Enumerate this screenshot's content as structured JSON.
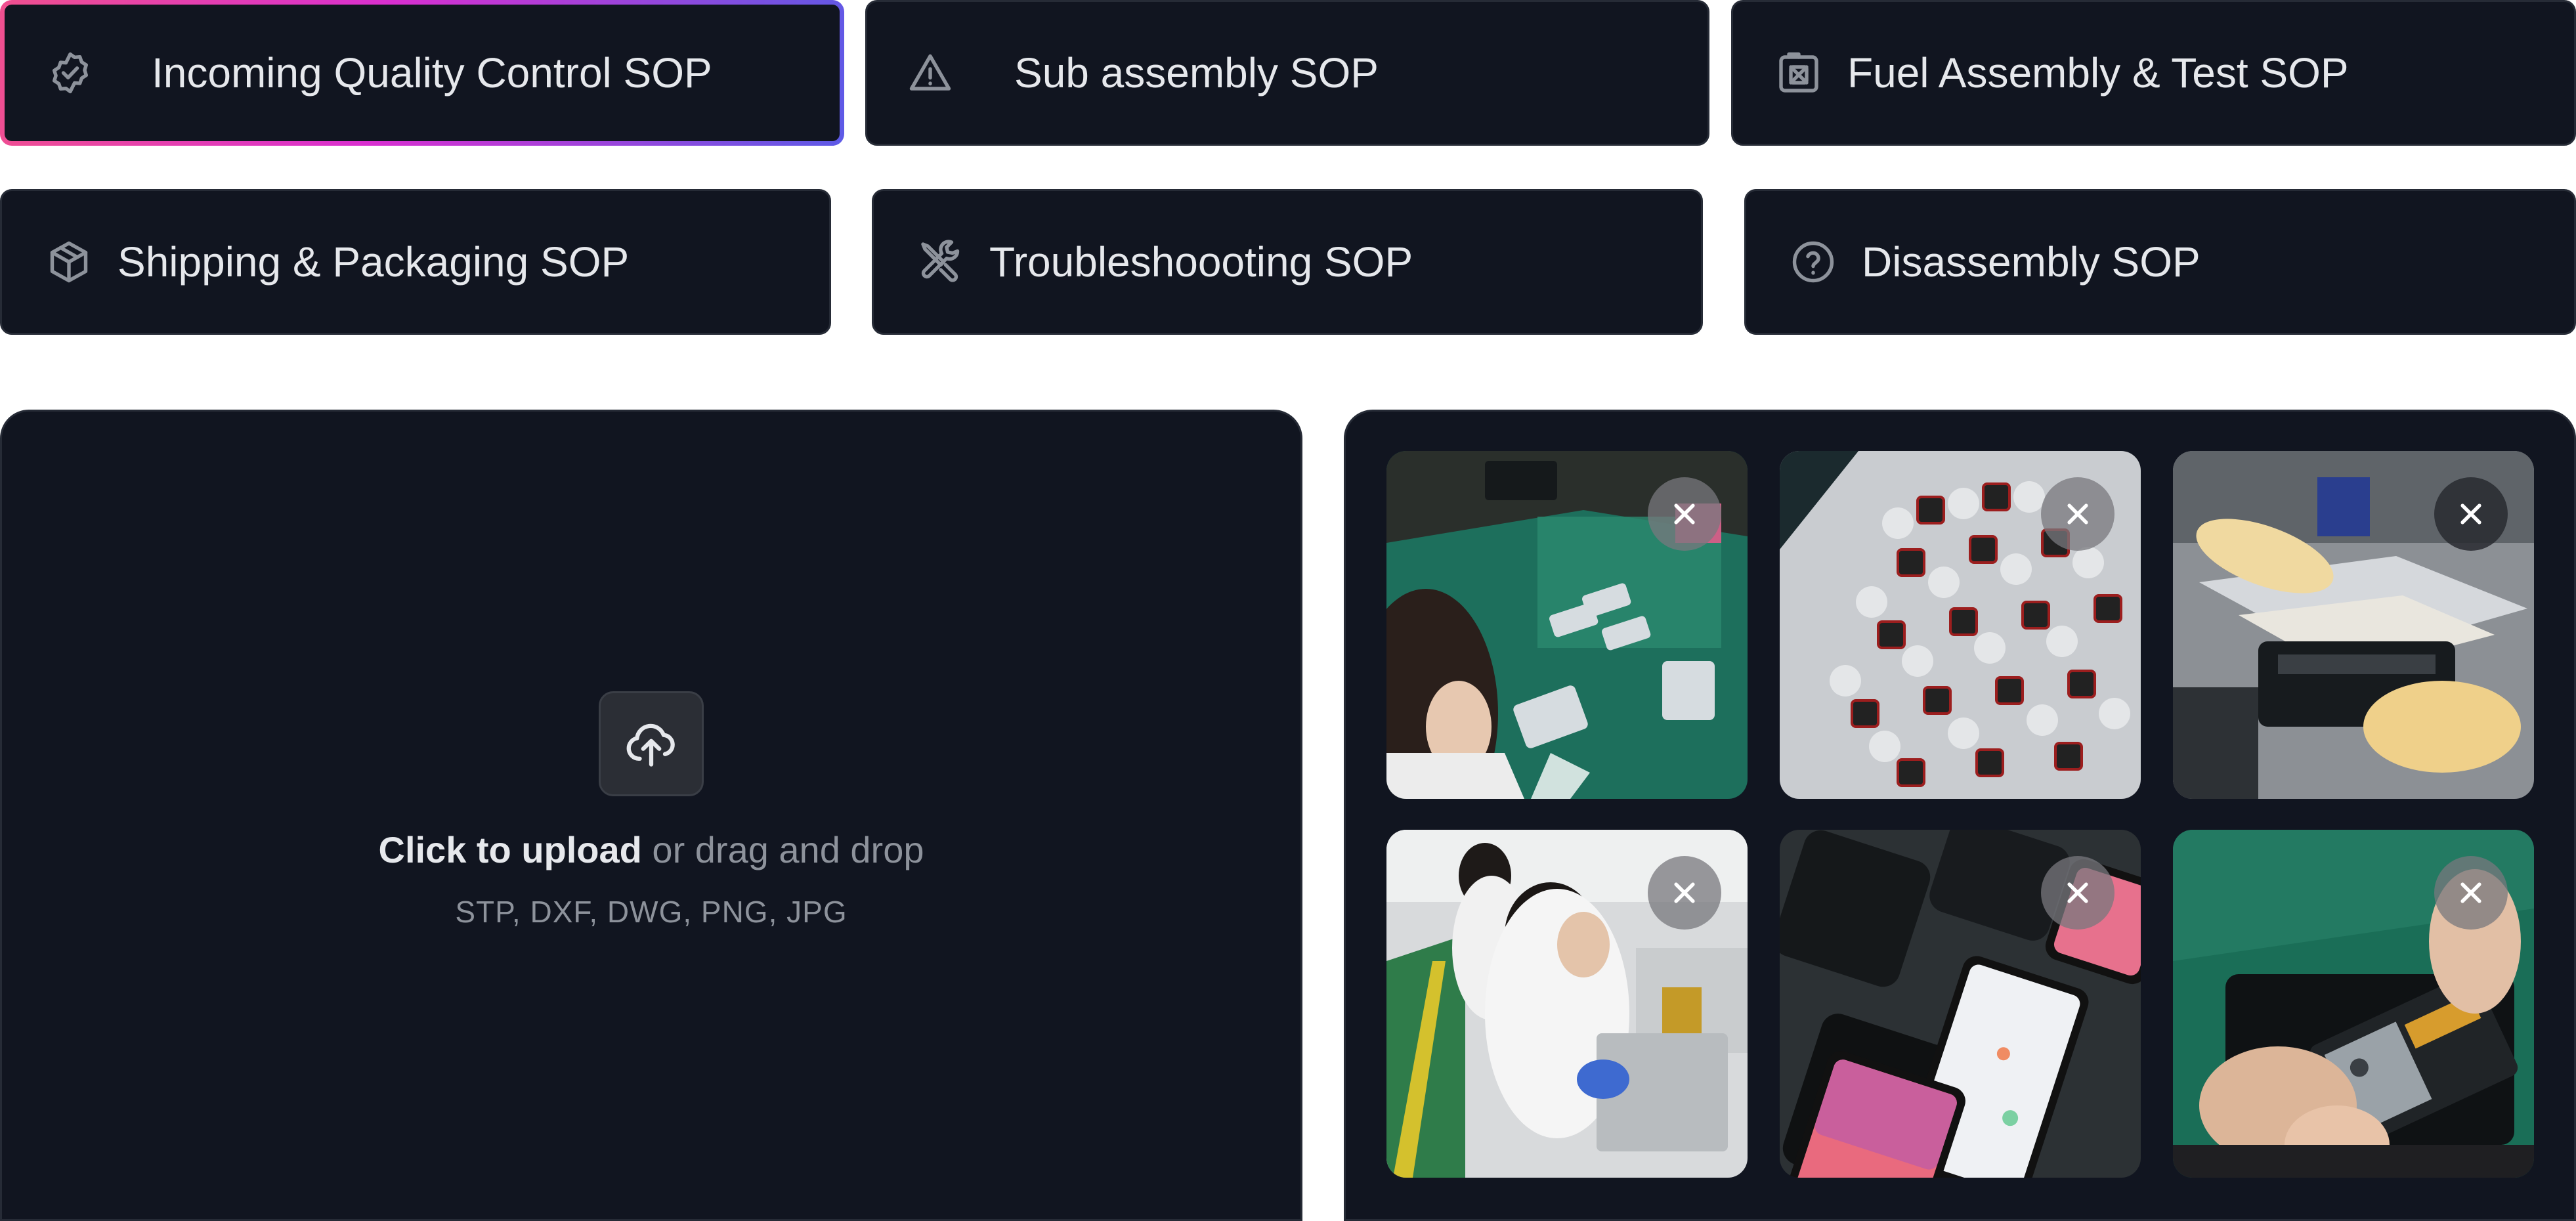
{
  "sop_tabs": [
    {
      "label": "Incoming Quality Control SOP",
      "icon": "badge-check-icon",
      "active": true
    },
    {
      "label": "Sub assembly SOP",
      "icon": "warning-triangle-icon",
      "active": false
    },
    {
      "label": "Fuel Assembly & Test SOP",
      "icon": "fuel-icon",
      "active": false
    },
    {
      "label": "Shipping & Packaging SOP",
      "icon": "package-icon",
      "active": false
    },
    {
      "label": "Troubleshoooting SOP",
      "icon": "wrench-screwdriver-icon",
      "active": false
    },
    {
      "label": "Disassembly SOP",
      "icon": "help-circle-icon",
      "active": false
    }
  ],
  "upload": {
    "icon": "cloud-upload-icon",
    "click_text": "Click to upload",
    "drag_text": " or drag and drop",
    "formats": "STP, DXF, DWG, PNG, JPG"
  },
  "gallery": {
    "images": [
      {
        "name": "phone-assembly-line-photo",
        "remove_icon": "close-icon"
      },
      {
        "name": "smartwatch-tray-photo",
        "remove_icon": "close-icon"
      },
      {
        "name": "screen-press-machine-photo",
        "remove_icon": "close-icon"
      },
      {
        "name": "workers-at-bench-photo",
        "remove_icon": "close-icon"
      },
      {
        "name": "phones-on-tray-photo",
        "remove_icon": "close-icon"
      },
      {
        "name": "phone-board-repair-photo",
        "remove_icon": "close-icon"
      }
    ]
  },
  "colors": {
    "panel_bg": "#111520",
    "active_gradient": [
      "#f0508f",
      "#d92fd0",
      "#5d5ae6"
    ]
  }
}
